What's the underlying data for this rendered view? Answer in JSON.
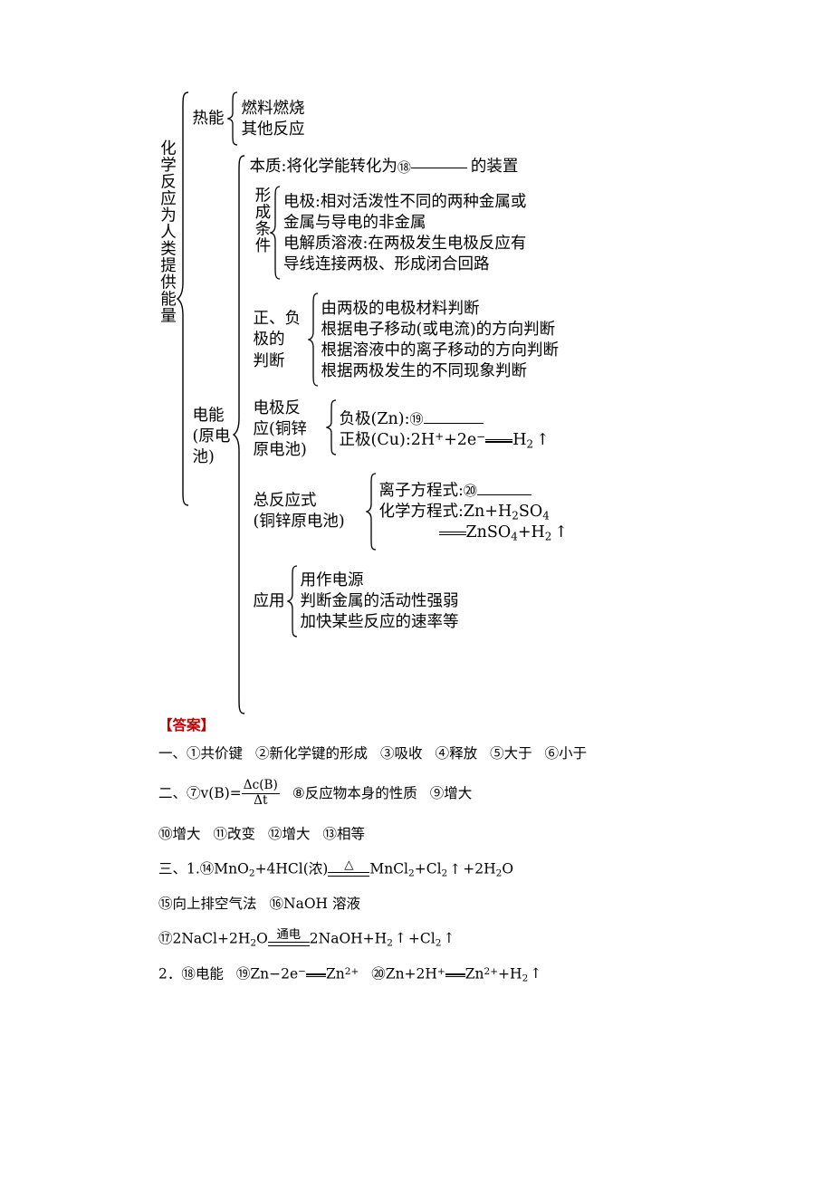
{
  "document": {
    "root_label": "化学反应为人类提供能量",
    "branches": {
      "thermal": {
        "label": "热能",
        "items": [
          "燃料燃烧",
          "其他反应"
        ]
      },
      "electrical": {
        "label_lines": [
          "电能",
          "(原电",
          "池)"
        ],
        "essence": {
          "prefix": "本质:将化学能转化为",
          "blank_number": "⑱",
          "suffix": "的装置"
        },
        "formation": {
          "label": "形成条件",
          "items": [
            "电极:相对活泼性不同的两种金属或",
            "金属与导电的非金属",
            "电解质溶液:在两极发生电极反应有",
            "导线连接两极、形成闭合回路"
          ]
        },
        "polarity": {
          "label_lines": [
            "正、负",
            "极的",
            "判断"
          ],
          "items": [
            "由两极的电极材料判断",
            "根据电子移动(或电流)的方向判断",
            "根据溶液中的离子移动的方向判断",
            "根据两极发生的不同现象判断"
          ]
        },
        "electrode_reaction": {
          "label_lines": [
            "电极反",
            "应(铜锌",
            "原电池)"
          ],
          "negative_prefix": "负极(Zn):",
          "negative_blank_number": "⑲",
          "positive_text_pre": "正极(Cu):2H",
          "positive_sup1": "+",
          "positive_mid": "+2e",
          "positive_sup2": "−",
          "positive_post": "H",
          "positive_sub": "2",
          "positive_arrow": "↑"
        },
        "overall_reaction": {
          "label_lines": [
            "总反应式",
            "(铜锌原电池)"
          ],
          "ionic_prefix": "离子方程式:",
          "ionic_blank_number": "⑳",
          "chemical_line1_pre": "化学方程式:Zn",
          "chemical_line1_plus": "+",
          "chemical_line1_h": "H",
          "chemical_line1_h_sub": "2",
          "chemical_line1_so": "SO",
          "chemical_line1_so_sub": "4",
          "chemical_line2_pre": "ZnSO",
          "chemical_line2_sub1": "4",
          "chemical_line2_plus": "+",
          "chemical_line2_h": "H",
          "chemical_line2_sub2": "2",
          "chemical_line2_arrow": "↑"
        },
        "application": {
          "label": "应用",
          "items": [
            "用作电源",
            "判断金属的活动性强弱",
            "加快某些反应的速率等"
          ]
        }
      }
    }
  },
  "answers": {
    "heading": "【答案】",
    "line1": {
      "prefix": "一、",
      "parts": [
        "①共价键",
        "②新化学键的形成",
        "③吸收",
        "④释放",
        "⑤大于",
        "⑥小于"
      ]
    },
    "line2": {
      "prefix": "二、",
      "item7_label": "⑦v(B)=",
      "item7_num": "Δc(B)",
      "item7_den": "Δt",
      "item8": "⑧反应物本身的性质",
      "item9": "⑨增大"
    },
    "line3": {
      "parts": [
        "⑩增大",
        "⑪改变",
        "⑫增大",
        "⑬相等"
      ]
    },
    "line4": {
      "prefix": "三、1.",
      "item14_pre": "⑭MnO",
      "item14_sub1": "2",
      "item14_plus": "+4HCl(浓)",
      "item14_cond": "△",
      "item14_post1": "MnCl",
      "item14_sub2": "2",
      "item14_plus2": "+Cl",
      "item14_sub3": "2",
      "item14_arrow": "↑",
      "item14_plus3": "+2H",
      "item14_sub4": "2",
      "item14_o": "O"
    },
    "line5": {
      "item15": "⑮向上排空气法",
      "item16": "⑯NaOH 溶液"
    },
    "line6": {
      "item17_pre": "⑰2NaCl+2H",
      "item17_sub1": "2",
      "item17_o": "O",
      "item17_cond": "通电",
      "item17_post": "2NaOH+H",
      "item17_sub2": "2",
      "item17_arrow1": "↑",
      "item17_plus": "+Cl",
      "item17_sub3": "2",
      "item17_arrow2": "↑"
    },
    "line7": {
      "prefix": "2．",
      "item18": "⑱电能",
      "item19_pre": "⑲Zn−2e",
      "item19_sup": "−",
      "item19_post": "Zn",
      "item19_sup2": "2+",
      "item20_pre": "⑳Zn+2H",
      "item20_sup": "+",
      "item20_post": "Zn",
      "item20_sup2": "2+",
      "item20_plus": "+H",
      "item20_sub": "2",
      "item20_arrow": "↑"
    }
  },
  "colors": {
    "answer_heading": "#c00000",
    "text": "#000000",
    "background": "#ffffff"
  }
}
